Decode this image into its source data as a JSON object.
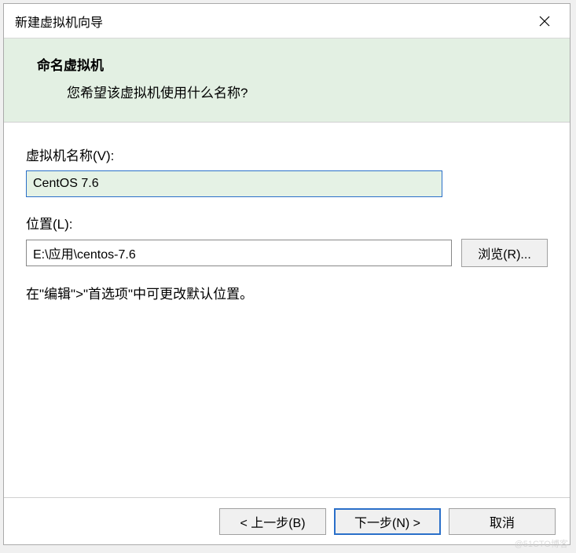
{
  "titlebar": {
    "title": "新建虚拟机向导"
  },
  "header": {
    "title": "命名虚拟机",
    "subtitle": "您希望该虚拟机使用什么名称?"
  },
  "form": {
    "vm_name_label": "虚拟机名称(V):",
    "vm_name_value": "CentOS 7.6",
    "location_label": "位置(L):",
    "location_value": "E:\\应用\\centos-7.6",
    "browse_label": "浏览(R)...",
    "hint": "在\"编辑\">\"首选项\"中可更改默认位置。"
  },
  "footer": {
    "back_label": "< 上一步(B)",
    "next_label": "下一步(N) >",
    "cancel_label": "取消"
  },
  "watermark": "@51CTO博客"
}
